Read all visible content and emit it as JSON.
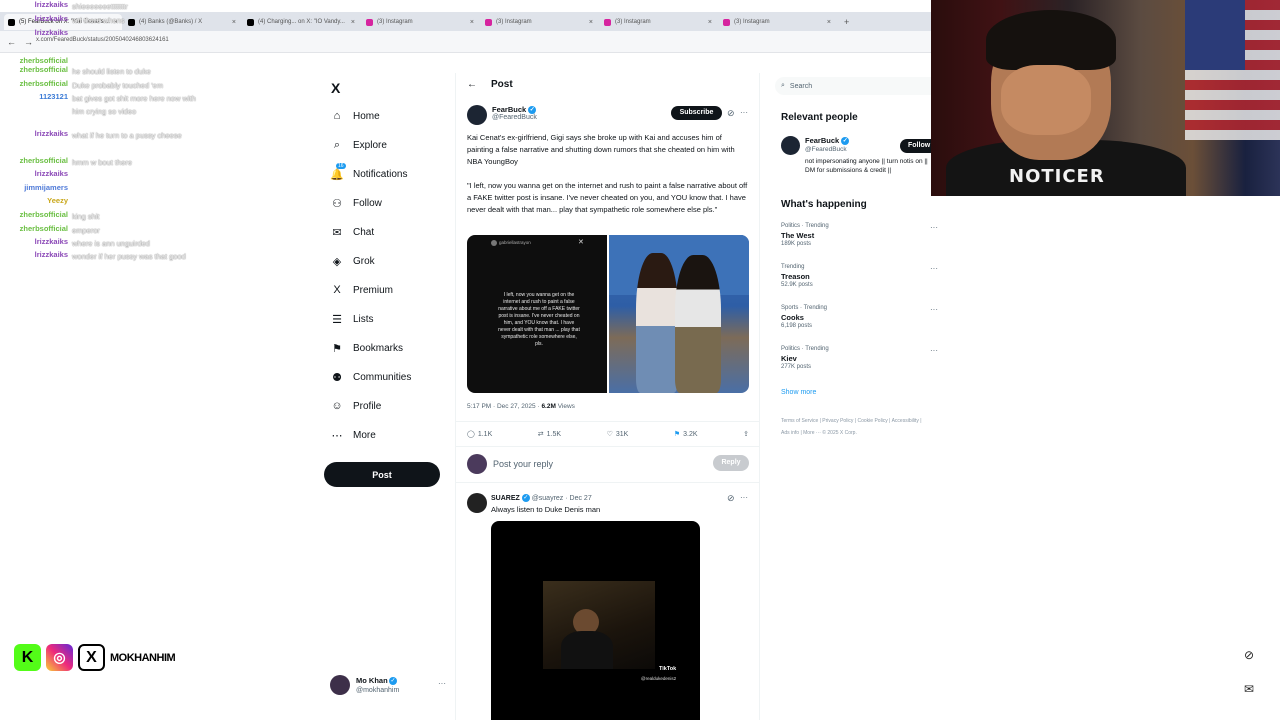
{
  "browser": {
    "tabs": [
      {
        "title": "(5) FearBuck on X: \"Kai Cenat's ...",
        "icon_color": "#000000"
      },
      {
        "title": "(4) Banks (@Banks) / X",
        "icon_color": "#000000"
      },
      {
        "title": "(4) Charging... on X: \"IO Vandy...",
        "icon_color": "#000000"
      },
      {
        "title": "(3) Instagram",
        "icon_color": "#d6249f"
      },
      {
        "title": "(3) Instagram",
        "icon_color": "#d6249f"
      },
      {
        "title": "(3) Instagram",
        "icon_color": "#d6249f"
      },
      {
        "title": "(3) Instagram",
        "icon_color": "#d6249f"
      }
    ],
    "url": "x.com/FearedBuck/status/2005040246803624161",
    "new_tab": "+",
    "back": "←",
    "forward": "→"
  },
  "chat": [
    {
      "user": "lrizzkaiks",
      "text": "shieeeeeeetttttttr",
      "color": "#8b48b7"
    },
    {
      "user": "lrizzkaiks",
      "text": "wtf there whens",
      "color": "#8b48b7"
    },
    {
      "user": "lrizzkaiks",
      "text": "",
      "color": "#8b48b7"
    },
    {
      "user": "zherbsofficial",
      "text": "",
      "color": "#6abf42"
    },
    {
      "user": "zherbsofficial",
      "text": "he should listen to duke",
      "color": "#6abf42"
    },
    {
      "user": "zherbsofficial",
      "text": "Duke probably touched 'em",
      "color": "#6abf42"
    },
    {
      "user": "1123121",
      "text": "bat gives got shit more here now with him crying so video",
      "color": "#3b7bd6"
    },
    {
      "user": "lrizzkaiks",
      "text": "what if he turn to a pussy cheese",
      "color": "#8b48b7"
    },
    {
      "user": "zherbsofficial",
      "text": "hmm w bout there",
      "color": "#6abf42"
    },
    {
      "user": "lrizzkaiks",
      "text": "",
      "color": "#8b48b7"
    },
    {
      "user": "jimmijamers",
      "text": "",
      "color": "#4f7ad8"
    },
    {
      "user": "Yeezy",
      "text": "",
      "color": "#c9a71a"
    },
    {
      "user": "zherbsofficial",
      "text": "king shit",
      "color": "#6abf42"
    },
    {
      "user": "zherbsofficial",
      "text": "emperor",
      "color": "#6abf42"
    },
    {
      "user": "lrizzkaiks",
      "text": "where is ann unguirded",
      "color": "#8b48b7"
    },
    {
      "user": "lrizzkaiks",
      "text": "wonder if her pussy was that good",
      "color": "#8b48b7"
    }
  ],
  "nav": {
    "items": [
      {
        "label": "Home",
        "icon": "⌂",
        "icon_name": "home-icon"
      },
      {
        "label": "Explore",
        "icon": "⌕",
        "icon_name": "search-icon"
      },
      {
        "label": "Notifications",
        "icon": "🔔",
        "icon_name": "bell-icon",
        "badge": "16"
      },
      {
        "label": "Follow",
        "icon": "⚇",
        "icon_name": "follow-icon"
      },
      {
        "label": "Chat",
        "icon": "✉",
        "icon_name": "chat-icon"
      },
      {
        "label": "Grok",
        "icon": "◈",
        "icon_name": "grok-icon"
      },
      {
        "label": "Premium",
        "icon": "X",
        "icon_name": "premium-icon"
      },
      {
        "label": "Lists",
        "icon": "☰",
        "icon_name": "lists-icon"
      },
      {
        "label": "Bookmarks",
        "icon": "⚑",
        "icon_name": "bookmark-icon"
      },
      {
        "label": "Communities",
        "icon": "⚉",
        "icon_name": "communities-icon"
      },
      {
        "label": "Profile",
        "icon": "☺",
        "icon_name": "profile-icon"
      },
      {
        "label": "More",
        "icon": "⋯",
        "icon_name": "more-icon"
      }
    ],
    "post_button": "Post",
    "me": {
      "name": "Mo Khan",
      "handle": "@mokhanhim",
      "menu": "···"
    }
  },
  "post": {
    "header": "Post",
    "back": "←",
    "author_name": "FearBuck",
    "author_handle": "@FearedBuck",
    "subscribe": "Subscribe",
    "text1": "Kai Cenat's ex-girlfriend, Gigi says she broke up with Kai and accuses him of painting a false narrative and shutting down rumors that she cheated on him with NBA YoungBoy",
    "text2": "\"I left, now you wanna get on the internet and rush to paint a false narrative about off a FAKE twitter post is insane. I've never cheated on you, and YOU know that. I have never dealt with that man... play that sympathetic role somewhere else pls.\"",
    "story_text": "I left, now you wanna get on the internet and rush to paint a false narrative about me off a FAKE twitter post is insane. I've never cheated on him, and YOU know that. I have never dealt with that man ... play that sympathetic role somewhere else, pls.",
    "story_user": "gabriellastrayon",
    "time": "5:17 PM · Dec 27, 2025 ·",
    "views_count": "6.2M",
    "views_label": "Views",
    "replies": "1.1K",
    "reposts": "1.5K",
    "likes": "31K",
    "bookmarks": "3.2K",
    "reply_placeholder": "Post your reply",
    "reply_button": "Reply"
  },
  "reply": {
    "author_name": "SUAREZ",
    "author_handle": "@suayrez",
    "date": "· Dec 27",
    "text": "Always listen to Duke Denis man",
    "tiktok_label": "TikTok",
    "tiktok_user": "@realdukedenis2"
  },
  "right": {
    "search_placeholder": "Search",
    "relevant_title": "Relevant people",
    "person_name": "FearBuck",
    "person_handle": "@FearedBuck",
    "person_bio": "not impersonating anyone || turn notis on || DM for submissions & credit ||",
    "follow": "Follow",
    "happening_title": "What's happening",
    "trends": [
      {
        "context": "Politics · Trending",
        "name": "The West",
        "count": "189K posts"
      },
      {
        "context": "Trending",
        "name": "Treason",
        "count": "52.9K posts"
      },
      {
        "context": "Sports · Trending",
        "name": "Cooks",
        "count": "6,198 posts"
      },
      {
        "context": "Politics · Trending",
        "name": "Kiev",
        "count": "277K posts"
      }
    ],
    "show_more": "Show more",
    "footer": "Terms of Service  |  Privacy Policy  |  Cookie Policy  |  Accessibility  |  Ads info  |  More ···  © 2025 X Corp."
  },
  "webcam": {
    "shirt_text": "NOTICER"
  },
  "socials": {
    "handle": "MOKHANHIM",
    "kick": "K",
    "x": "X"
  }
}
